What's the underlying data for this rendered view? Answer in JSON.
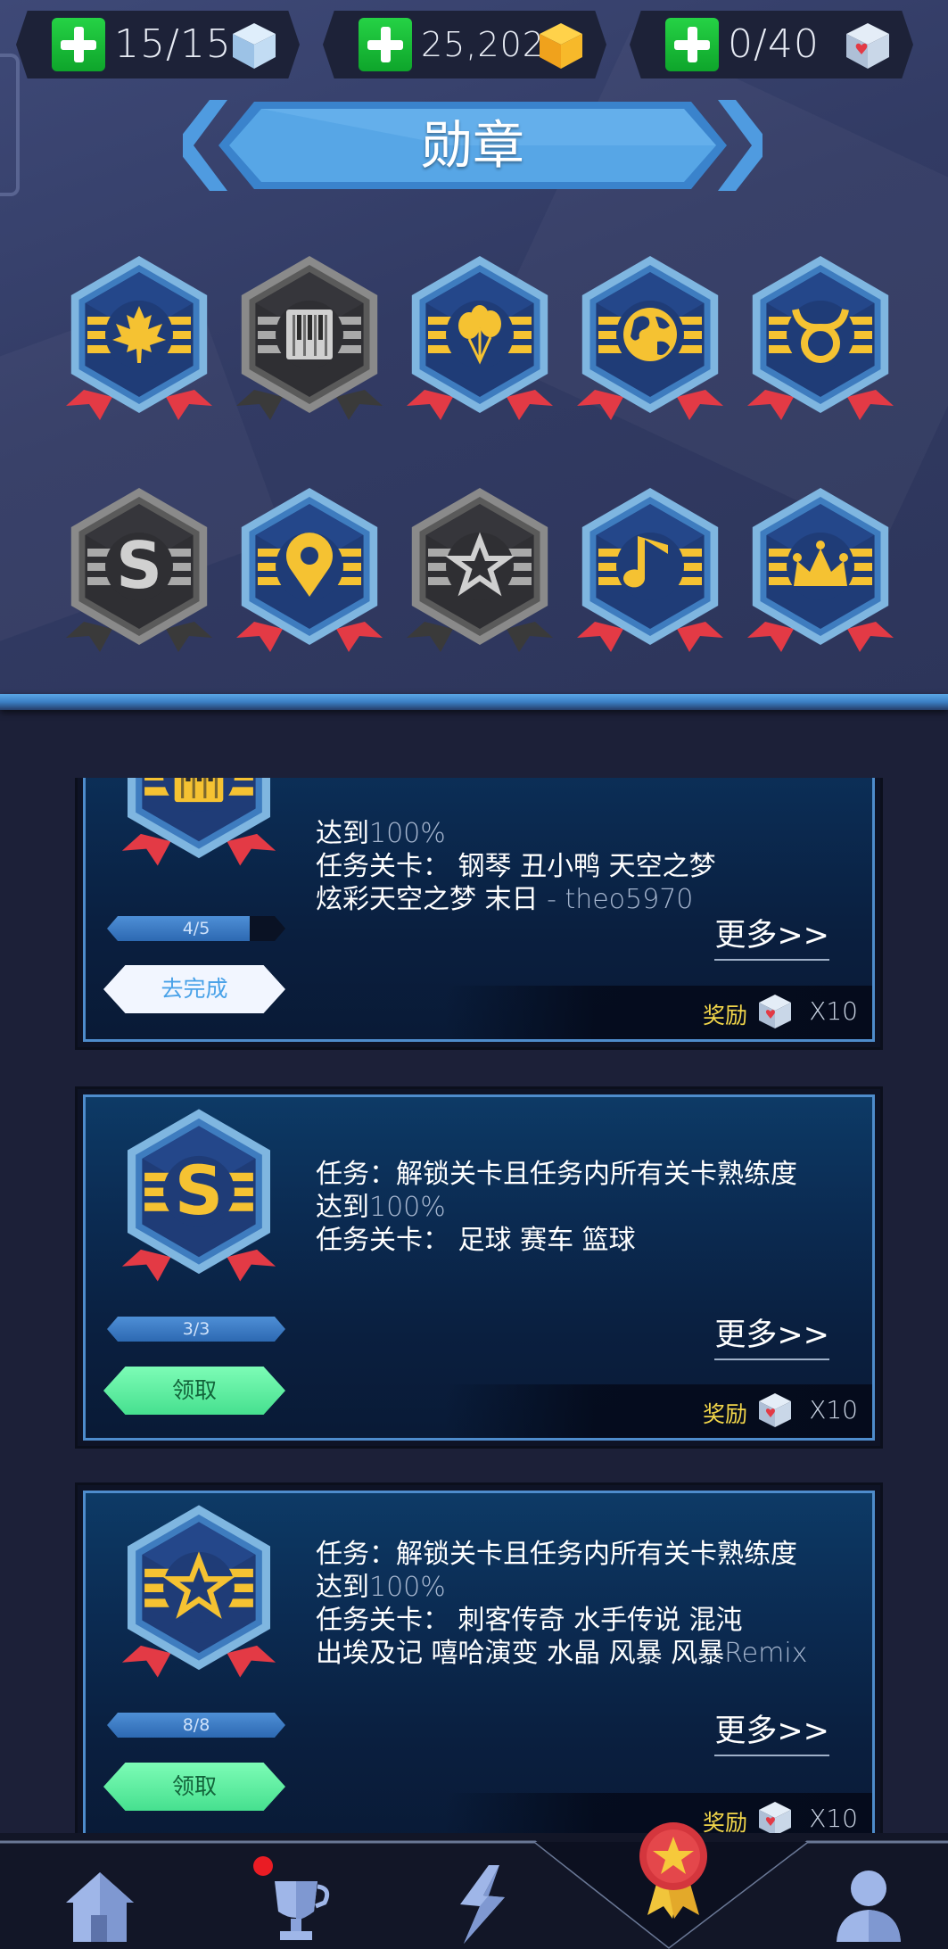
{
  "currency": [
    {
      "value": "15/15",
      "icon": "energy-cube-icon"
    },
    {
      "value": "25,202",
      "icon": "gold-cube-icon"
    },
    {
      "value": "0/40",
      "icon": "heart-cube-icon"
    }
  ],
  "title": "勋章",
  "medals": [
    {
      "icon": "maple-leaf-icon",
      "state": "unlocked"
    },
    {
      "icon": "piano-icon",
      "state": "locked"
    },
    {
      "icon": "balloons-icon",
      "state": "unlocked"
    },
    {
      "icon": "globe-icon",
      "state": "unlocked"
    },
    {
      "icon": "taurus-icon",
      "state": "unlocked"
    },
    {
      "icon": "letter-s-icon",
      "state": "locked"
    },
    {
      "icon": "location-pin-icon",
      "state": "unlocked"
    },
    {
      "icon": "star-icon",
      "state": "locked"
    },
    {
      "icon": "music-note-icon",
      "state": "unlocked"
    },
    {
      "icon": "jester-hat-icon",
      "state": "unlocked"
    }
  ],
  "missions": [
    {
      "medal_icon": "piano-icon",
      "lines": [
        {
          "text": "达到",
          "dim": "100%"
        },
        {
          "text": "任务关卡：  钢琴 丑小鸭 天空之梦",
          "dim": ""
        },
        {
          "text": "炫彩天空之梦 末日 ",
          "dim": "- theo5970"
        }
      ],
      "progress": "4/5",
      "progress_value": 0.8,
      "button": "去完成",
      "more": "更多>>",
      "reward_label": "奖励",
      "reward_qty": "X10"
    },
    {
      "medal_icon": "letter-s-icon",
      "lines": [
        {
          "text": "任务：解锁关卡且任务内所有关卡熟练度",
          "dim": ""
        },
        {
          "text": "达到",
          "dim": "100%"
        },
        {
          "text": "任务关卡：  足球 赛车 篮球",
          "dim": ""
        }
      ],
      "progress": "3/3",
      "progress_value": 1.0,
      "button": "领取",
      "more": "更多>>",
      "reward_label": "奖励",
      "reward_qty": "X10"
    },
    {
      "medal_icon": "star-icon",
      "lines": [
        {
          "text": "任务：解锁关卡且任务内所有关卡熟练度",
          "dim": ""
        },
        {
          "text": "达到",
          "dim": "100%"
        },
        {
          "text": "任务关卡：  刺客传奇 水手传说 混沌",
          "dim": ""
        },
        {
          "text": "出埃及记 嘻哈演变 水晶 风暴 风暴",
          "dim": "Remix"
        }
      ],
      "progress": "8/8",
      "progress_value": 1.0,
      "button": "领取",
      "more": "更多>>",
      "reward_label": "奖励",
      "reward_qty": "X10"
    }
  ],
  "nav": [
    {
      "name": "home",
      "icon": "home-icon",
      "badge": false,
      "active": false
    },
    {
      "name": "trophy",
      "icon": "trophy-icon",
      "badge": true,
      "active": false
    },
    {
      "name": "levels",
      "icon": "lightning-icon",
      "badge": false,
      "active": false
    },
    {
      "name": "medals",
      "icon": "medal-icon",
      "badge": false,
      "active": true
    },
    {
      "name": "profile",
      "icon": "profile-icon",
      "badge": false,
      "active": false
    }
  ],
  "colors": {
    "accent_blue": "#4e8ccc",
    "gold": "#f5c232",
    "ribbon_red": "#e33a45",
    "claim_green": "#5cf0a0",
    "reward_yellow": "#f2d64a"
  }
}
